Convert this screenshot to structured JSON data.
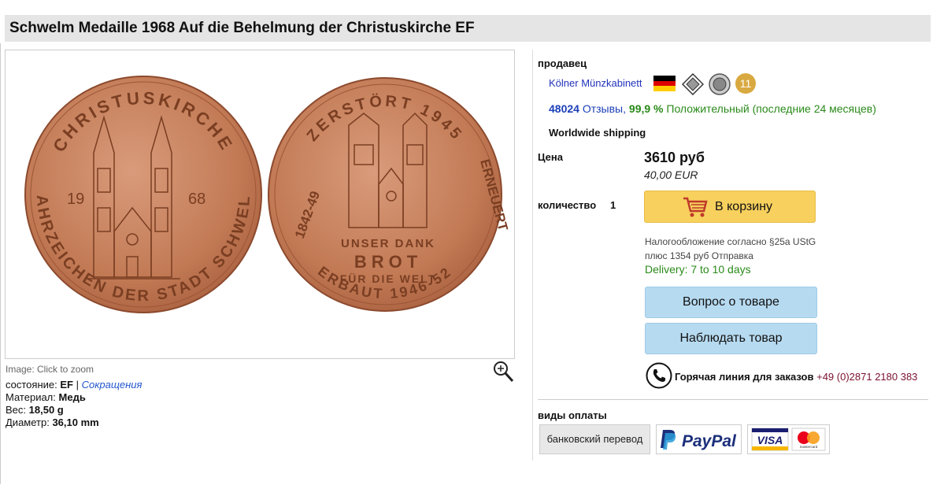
{
  "title": "Schwelm Medaille 1968 Auf die Behelmung der Christuskirche EF",
  "image": {
    "caption": "Image: Click to zoom",
    "obverse_text_top": "CHRISTUSKIRCHE",
    "obverse_text_bottom": "WAHRZEICHEN DER STADT SCHWELM",
    "obverse_year_left": "19",
    "obverse_year_right": "68",
    "reverse_text_top": "ZERSTÖRT 1945",
    "reverse_text_left": "1842-49",
    "reverse_text_right": "ERNEUERT",
    "reverse_text_bottom": "ERBAUT 1946-52",
    "reverse_center": [
      "UNSER DANK",
      "BROT",
      "FÜR DIE WELT"
    ]
  },
  "attributes": {
    "condition_label": "состояние:",
    "condition_value": "EF",
    "sep": "|",
    "abbr_link": "Сокращения",
    "material_label": "Материал:",
    "material_value": "Медь",
    "weight_label": "Вес:",
    "weight_value": "18,50 g",
    "diameter_label": "Диаметр:",
    "diameter_value": "36,10 mm"
  },
  "seller": {
    "label": "продавец",
    "name": "Kölner Münzkabinett",
    "badge_count": "11",
    "feedback_count": "48024",
    "feedback_word": "Отзывы,",
    "positive_pct": "99,9 %",
    "positive_text": "Положительный (последние 24 месяцев)",
    "shipping": "Worldwide shipping"
  },
  "price": {
    "label": "Цена",
    "main": "3610 руб",
    "eur": "40,00 EUR"
  },
  "quantity": {
    "label": "количество",
    "value": "1"
  },
  "cart_button": "В корзину",
  "tax": {
    "line1": "Налогообложение согласно §25a UStG",
    "line2": "плюс 1354 руб Отправка"
  },
  "delivery": "Delivery: 7 to 10 days",
  "question_button": "Вопрос о товаре",
  "watch_button": "Наблюдать товар",
  "hotline": {
    "label": "Горячая линия для заказов",
    "number": "+49 (0)2871 2180 383"
  },
  "payment": {
    "label": "виды оплаты",
    "bank": "банковский перевод",
    "paypal": "PayPal",
    "visa": "VISA",
    "mastercard": "mastercard"
  },
  "colors": {
    "coin": "#c9805a",
    "cart_button": "#f7d05d",
    "blue_button": "#b6daf0",
    "link": "#2233bb",
    "positive": "#2a8a1a"
  }
}
